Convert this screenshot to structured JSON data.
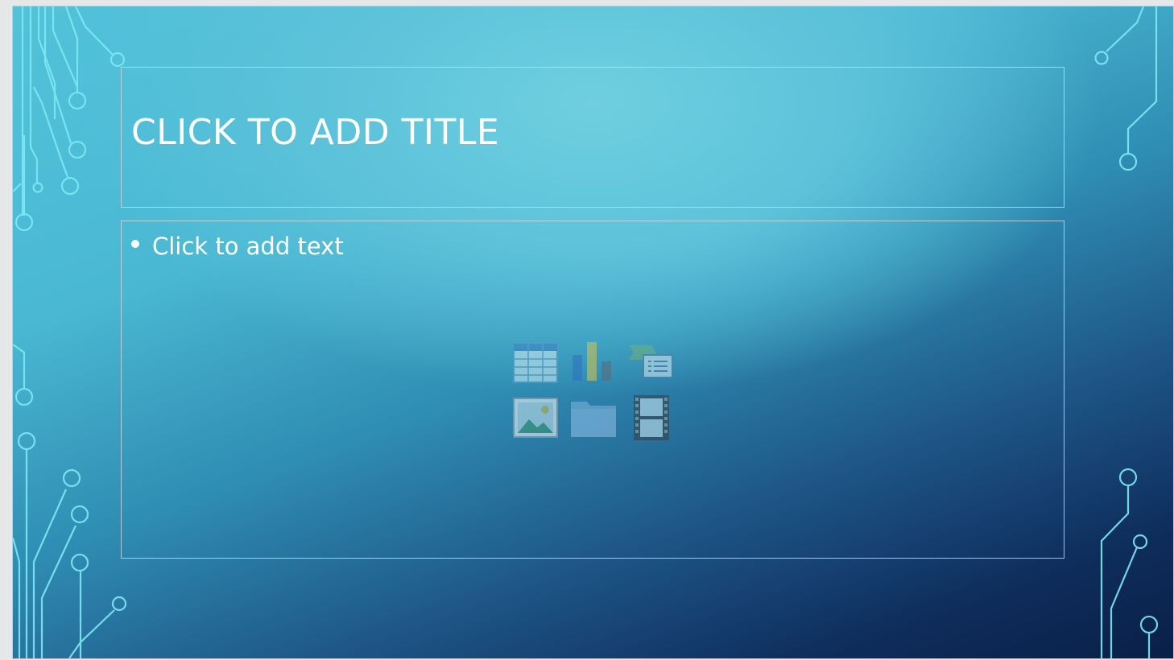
{
  "slide": {
    "title_placeholder": "CLICK TO ADD TITLE",
    "body_placeholder": "Click to add text"
  },
  "insert_icons": [
    {
      "name": "table-icon",
      "label": "Insert Table"
    },
    {
      "name": "chart-icon",
      "label": "Insert Chart"
    },
    {
      "name": "smartart-icon",
      "label": "Insert SmartArt Graphic"
    },
    {
      "name": "picture-icon",
      "label": "Pictures"
    },
    {
      "name": "folder-icon",
      "label": "Picture from File"
    },
    {
      "name": "video-icon",
      "label": "Insert Video"
    }
  ],
  "colors": {
    "background_top": "#52c2d9",
    "background_bottom": "#0a1f4a",
    "circuit_line": "#7ee6f2",
    "placeholder_border": "#cdd7de",
    "text": "#ffffff"
  }
}
